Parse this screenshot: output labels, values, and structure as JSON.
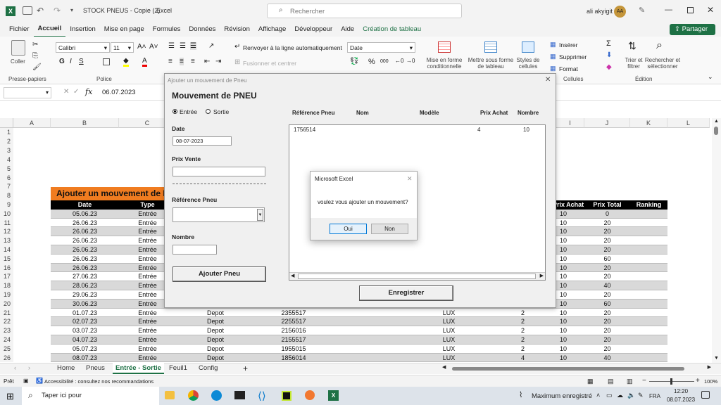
{
  "titlebar": {
    "filename": "STOCK PNEUS - Copie (2)",
    "sep": "-",
    "app": "Excel",
    "search": "Rechercher",
    "user": "ali akyigit",
    "initials": "AA"
  },
  "menu": [
    "Fichier",
    "Accueil",
    "Insertion",
    "Mise en page",
    "Formules",
    "Données",
    "Révision",
    "Affichage",
    "Développeur",
    "Aide",
    "Création de tableau"
  ],
  "share": "Partager",
  "ribbon": {
    "paste": "Coller",
    "clipboard": "Presse-papiers",
    "font_name": "Calibri",
    "font_size": "11",
    "font": "Police",
    "wrap": "Renvoyer à la ligne automatiquement",
    "merge": "Fusionner et centrer",
    "number_format": "Date",
    "cond_format": "Mise en forme conditionnelle",
    "as_table": "Mettre sous forme de tableau",
    "styles": "Styles de cellules",
    "insert": "Insérer",
    "delete": "Supprimer",
    "format": "Format",
    "cells": "Cellules",
    "sort": "Trier et filtrer",
    "find": "Rechercher et sélectionner",
    "edit": "Édition"
  },
  "formula": {
    "value": "06.07.2023"
  },
  "columns": [
    "A",
    "B",
    "C",
    "D",
    "E",
    "F",
    "G",
    "H",
    "I",
    "J",
    "K",
    "L"
  ],
  "sheet": {
    "title": "Ajouter un mouvement de Pneu",
    "headers": {
      "date": "Date",
      "type": "Type",
      "achat": "Prix Achat",
      "total": "Prix Total",
      "ranking": "Ranking"
    },
    "rows": [
      {
        "n": "10",
        "date": "05.06.23",
        "type": "Entrée",
        "loc": "",
        "ref": "",
        "mod": "",
        "qty": "",
        "pa": "10",
        "pt": "0"
      },
      {
        "n": "11",
        "date": "26.06.23",
        "type": "Entrée",
        "loc": "",
        "ref": "",
        "mod": "",
        "qty": "",
        "pa": "10",
        "pt": "20"
      },
      {
        "n": "12",
        "date": "26.06.23",
        "type": "Entrée",
        "loc": "",
        "ref": "",
        "mod": "",
        "qty": "",
        "pa": "10",
        "pt": "20"
      },
      {
        "n": "13",
        "date": "26.06.23",
        "type": "Entrée",
        "loc": "",
        "ref": "",
        "mod": "",
        "qty": "",
        "pa": "10",
        "pt": "20"
      },
      {
        "n": "14",
        "date": "26.06.23",
        "type": "Entrée",
        "loc": "",
        "ref": "",
        "mod": "",
        "qty": "",
        "pa": "10",
        "pt": "20"
      },
      {
        "n": "15",
        "date": "26.06.23",
        "type": "Entrée",
        "loc": "",
        "ref": "",
        "mod": "",
        "qty": "",
        "pa": "10",
        "pt": "60"
      },
      {
        "n": "16",
        "date": "26.06.23",
        "type": "Entrée",
        "loc": "",
        "ref": "",
        "mod": "",
        "qty": "",
        "pa": "10",
        "pt": "20"
      },
      {
        "n": "17",
        "date": "27.06.23",
        "type": "Entrée",
        "loc": "",
        "ref": "",
        "mod": "",
        "qty": "",
        "pa": "10",
        "pt": "20"
      },
      {
        "n": "18",
        "date": "28.06.23",
        "type": "Entrée",
        "loc": "",
        "ref": "",
        "mod": "",
        "qty": "",
        "pa": "10",
        "pt": "40"
      },
      {
        "n": "19",
        "date": "29.06.23",
        "type": "Entrée",
        "loc": "",
        "ref": "",
        "mod": "",
        "qty": "",
        "pa": "10",
        "pt": "20"
      },
      {
        "n": "20",
        "date": "30.06.23",
        "type": "Entrée",
        "loc": "",
        "ref": "",
        "mod": "",
        "qty": "",
        "pa": "10",
        "pt": "60"
      },
      {
        "n": "21",
        "date": "01.07.23",
        "type": "Entrée",
        "loc": "Depot",
        "ref": "2355517",
        "mod": "LUX",
        "qty": "2",
        "pa": "10",
        "pt": "20"
      },
      {
        "n": "22",
        "date": "02.07.23",
        "type": "Entrée",
        "loc": "Depot",
        "ref": "2255517",
        "mod": "LUX",
        "qty": "2",
        "pa": "10",
        "pt": "20"
      },
      {
        "n": "23",
        "date": "03.07.23",
        "type": "Entrée",
        "loc": "Depot",
        "ref": "2156016",
        "mod": "LUX",
        "qty": "2",
        "pa": "10",
        "pt": "20"
      },
      {
        "n": "24",
        "date": "04.07.23",
        "type": "Entrée",
        "loc": "Depot",
        "ref": "2155517",
        "mod": "LUX",
        "qty": "2",
        "pa": "10",
        "pt": "20"
      },
      {
        "n": "25",
        "date": "05.07.23",
        "type": "Entrée",
        "loc": "Depot",
        "ref": "1955015",
        "mod": "LUX",
        "qty": "2",
        "pa": "10",
        "pt": "20"
      },
      {
        "n": "26",
        "date": "08.07.23",
        "type": "Entrée",
        "loc": "Depot",
        "ref": "1856014",
        "mod": "LUX",
        "qty": "4",
        "pa": "10",
        "pt": "40"
      }
    ]
  },
  "tabs": [
    "Home",
    "Pneus",
    "Entrée - Sortie",
    "Feuil1",
    "Config"
  ],
  "status": {
    "ready": "Prêt",
    "access": "Accessibilité : consultez nos recommandations",
    "zoom": "100%"
  },
  "taskbar": {
    "search": "Taper ici pour",
    "weather": "Maximum enregistré",
    "lang": "FRA",
    "time": "12:20",
    "date": "08.07.2023"
  },
  "form": {
    "window_title": "Ajouter un mouvement de Pneu",
    "heading": "Mouvement de PNEU",
    "radio_in": "Entrée",
    "radio_out": "Sortie",
    "date_label": "Date",
    "date_value": "08-07-2023",
    "price_label": "Prix Vente",
    "ref_label": "Référence Pneu",
    "qty_label": "Nombre",
    "add_btn": "Ajouter Pneu",
    "list_headers": [
      "Référence Pneu",
      "Nom",
      "Modèle",
      "Prix Achat",
      "Nombre"
    ],
    "list_row": {
      "ref": "1756514",
      "price": "4",
      "qty": "10"
    },
    "save_btn": "Enregistrer"
  },
  "msgbox": {
    "title": "Microsoft Excel",
    "text": "voulez vous ajouter un mouvement?",
    "yes": "Oui",
    "no": "Non"
  }
}
